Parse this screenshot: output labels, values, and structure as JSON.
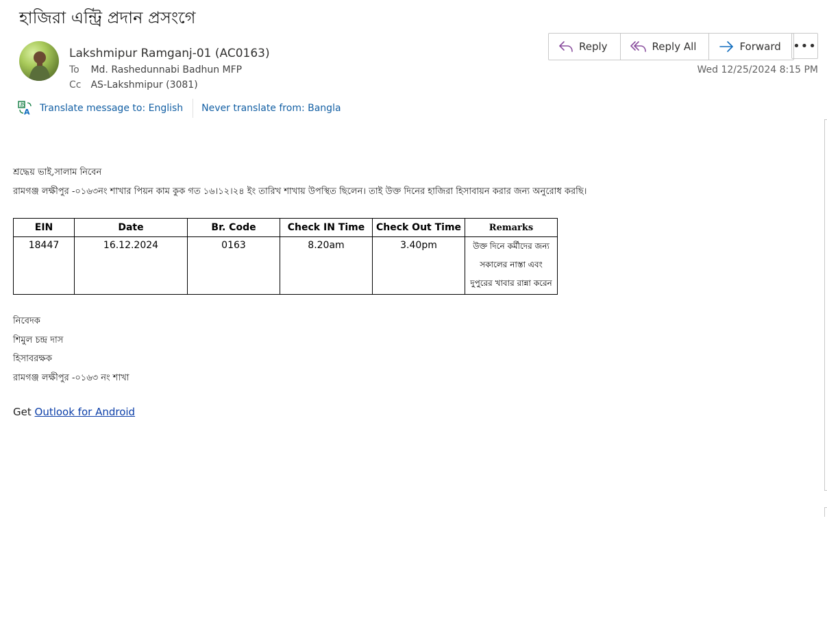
{
  "email": {
    "subject": "হাজিরা এন্ট্রি প্রদান প্রসংগে",
    "sender": "Lakshmipur Ramganj-01 (AC0163)",
    "to_label": "To",
    "to": "Md. Rashedunnabi Badhun MFP",
    "cc_label": "Cc",
    "cc": "AS-Lakshmipur (3081)",
    "datetime": "Wed 12/25/2024 8:15 PM"
  },
  "actions": {
    "reply": "Reply",
    "reply_all": "Reply All",
    "forward": "Forward",
    "more": "•••"
  },
  "translate": {
    "translate_to": "Translate message to: English",
    "never_translate": "Never translate from: Bangla"
  },
  "body": {
    "greeting": "শ্রদ্ধেয় ভাই,সালাম নিবেন",
    "paragraph": "রামগঞ্জ লক্ষীপুর -০১৬৩নং শাখার পিয়ন কাম কুক গত ১৬।১২।২৪ ইং তারিখ শাখায় উপস্থিত ছিলেন। তাই উক্ত দিনের হাজিরা হিসাবায়ন করার জন্য অনুরোধ করছি।",
    "table": {
      "headers": [
        "EIN",
        "Date",
        "Br. Code",
        "Check IN Time",
        "Check Out Time",
        "Remarks"
      ],
      "row": [
        "18447",
        "16.12.2024",
        "0163",
        "8.20am",
        "3.40pm"
      ],
      "remarks_lines": [
        "উক্ত দিনে কর্মীদের জন্য",
        "সকালের নাস্তা এবং",
        "দুপুরের খাবার রান্না করেন"
      ]
    },
    "signature": [
      "নিবেদক",
      "শিমুল চন্দ্র দাস",
      "হিসাবরক্ষক",
      "রামগঞ্জ লক্ষীপুর -০১৬৩ নং শাখা"
    ],
    "get_prefix": "Get",
    "get_link": "Outlook for Android"
  },
  "colors": {
    "link": "#115ea3",
    "accent": "#0f6cbd"
  }
}
